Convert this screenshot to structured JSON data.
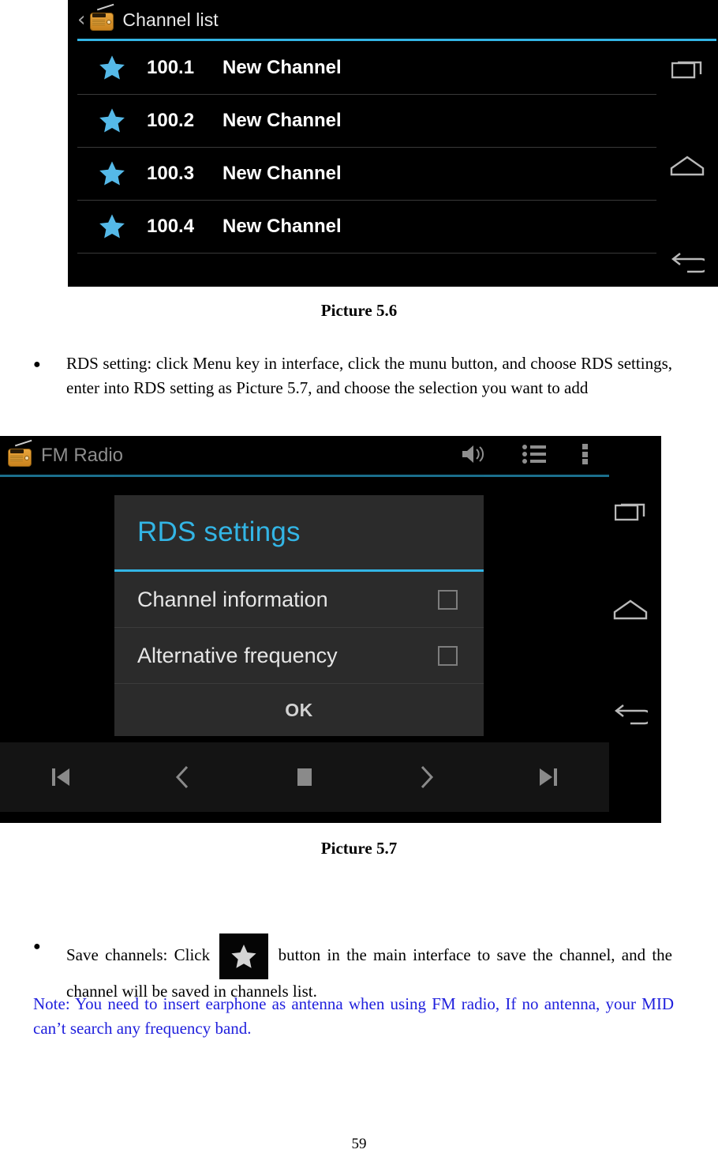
{
  "document": {
    "page_number": "59",
    "caption_5_6": "Picture 5.6",
    "caption_5_7": "Picture 5.7",
    "bullet_marker": "●",
    "paragraph_rds": "RDS setting: click Menu key in interface, click the munu button, and choose RDS settings, enter into RDS setting as Picture 5.7, and choose the selection you want to add",
    "paragraph_save_before": "Save channels: Click",
    "paragraph_save_after": "button in the main interface to save the channel, and the channel will be saved in channels list.",
    "note": "Note: You need to insert earphone as antenna when using FM radio, If no antenna, your MID can’t search any frequency band.",
    "note_color": "#2020dd"
  },
  "channel_list_screen": {
    "title": "Channel list",
    "back_chevron": "‹",
    "accent_color": "#33b5e5",
    "star_color": "#55b9e8",
    "rows": [
      {
        "frequency": "100.1",
        "name": "New Channel"
      },
      {
        "frequency": "100.2",
        "name": "New Channel"
      },
      {
        "frequency": "100.3",
        "name": "New Channel"
      },
      {
        "frequency": "100.4",
        "name": "New Channel"
      }
    ],
    "nav": {
      "recents": "recent-apps",
      "home": "home",
      "back": "back"
    }
  },
  "fm_radio_screen": {
    "title": "FM Radio",
    "accent_color": "#1b6f8c",
    "header_icons": [
      "speaker-icon",
      "channel-list-icon",
      "overflow-menu-icon"
    ],
    "dialog": {
      "title": "RDS settings",
      "title_color": "#33b5e5",
      "options": [
        {
          "label": "Channel information",
          "checked": false
        },
        {
          "label": "Alternative frequency",
          "checked": false
        }
      ],
      "ok_label": "OK"
    },
    "transport": [
      "skip-previous-icon",
      "seek-backward-icon",
      "stop-icon",
      "seek-forward-icon",
      "skip-next-icon"
    ],
    "nav": {
      "recents": "recent-apps",
      "home": "home",
      "back": "back"
    }
  }
}
